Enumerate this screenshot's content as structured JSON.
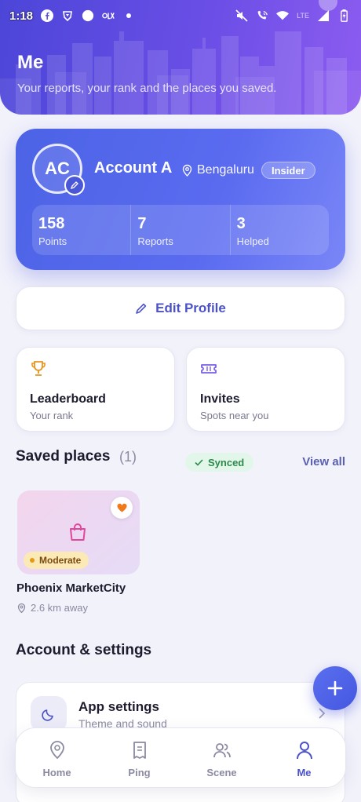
{
  "status_bar": {
    "time": "1:18",
    "network": "LTE"
  },
  "header": {
    "title": "Me",
    "subtitle": "Your reports, your rank and the places you saved."
  },
  "profile": {
    "initials": "AC",
    "name": "Account A",
    "location": "Bengaluru",
    "badge": "Insider",
    "stats": [
      {
        "value": "158",
        "label": "Points"
      },
      {
        "value": "7",
        "label": "Reports"
      },
      {
        "value": "3",
        "label": "Helped"
      }
    ]
  },
  "edit_profile": {
    "label": "Edit Profile"
  },
  "tiles": [
    {
      "title": "Leaderboard",
      "subtitle": "Your rank",
      "icon": "trophy-icon"
    },
    {
      "title": "Invites",
      "subtitle": "Spots near you",
      "icon": "ticket-icon"
    }
  ],
  "saved": {
    "heading": "Saved places",
    "count": "(1)",
    "sync_label": "Synced",
    "view_all": "View all",
    "places": [
      {
        "name": "Phoenix MarketCity",
        "crowd": "Moderate",
        "distance": "2.6 km away"
      }
    ]
  },
  "account_settings": {
    "heading": "Account & settings",
    "items": [
      {
        "title": "App settings",
        "subtitle": "Theme and sound",
        "icon": "moon-icon"
      }
    ]
  },
  "nav": {
    "items": [
      {
        "label": "Home",
        "icon": "location-pin-icon",
        "active": false
      },
      {
        "label": "Ping",
        "icon": "document-icon",
        "active": false
      },
      {
        "label": "Scene",
        "icon": "people-icon",
        "active": false
      },
      {
        "label": "Me",
        "icon": "person-icon",
        "active": true
      }
    ]
  },
  "colors": {
    "accent": "#4b52c9",
    "header_gradient_start": "#4c46d8",
    "header_gradient_end": "#8d5cf0",
    "synced_text": "#2d8a4c",
    "moderate_bg": "#fbe9b6",
    "heart": "#f07a1a"
  }
}
